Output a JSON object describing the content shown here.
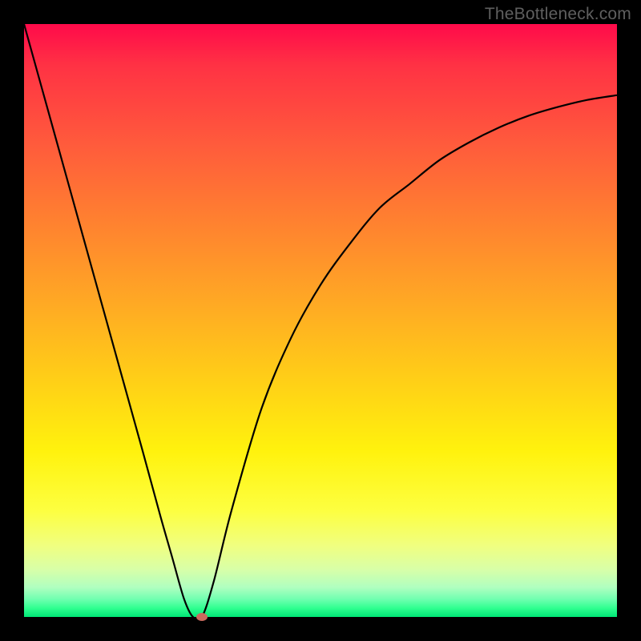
{
  "watermark": "TheBottleneck.com",
  "colors": {
    "top": "#ff0a4a",
    "mid": "#ffcc18",
    "bottom": "#00e676",
    "curve": "#000000",
    "dot": "#c96a5e",
    "frame": "#000000"
  },
  "chart_data": {
    "type": "line",
    "title": "",
    "xlabel": "",
    "ylabel": "",
    "xlim": [
      0,
      100
    ],
    "ylim": [
      0,
      100
    ],
    "x": [
      0,
      5,
      10,
      15,
      20,
      23,
      25,
      27,
      28.5,
      30,
      32,
      35,
      40,
      45,
      50,
      55,
      60,
      65,
      70,
      75,
      80,
      85,
      90,
      95,
      100
    ],
    "values": [
      100,
      82,
      64,
      46,
      28,
      17,
      10,
      3,
      0,
      0,
      6,
      18,
      35,
      47,
      56,
      63,
      69,
      73,
      77,
      80,
      82.5,
      84.5,
      86,
      87.2,
      88
    ],
    "marker": {
      "x": 30,
      "y": 0
    },
    "annotations": []
  }
}
